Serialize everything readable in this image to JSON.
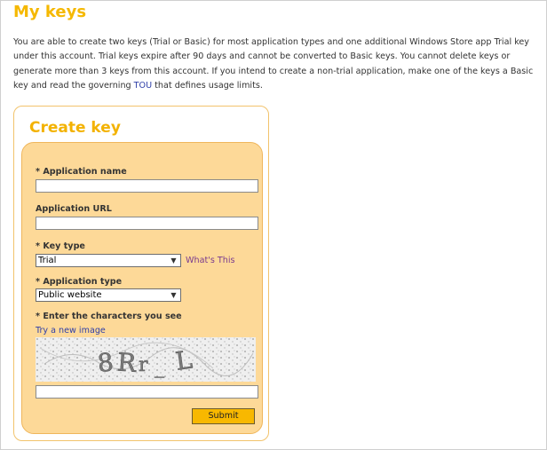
{
  "page": {
    "title": "My keys",
    "intro_text": "You are able to create two keys (Trial or Basic) for most application types and one additional Windows Store app Trial key under this account. Trial keys expire after 90 days and cannot be converted to Basic keys. You cannot delete keys or generate more than 3 keys from this account. If you intend to create a non-trial application, make one of the keys a Basic key and read the governing ",
    "tou_link": "TOU",
    "intro_text_end": " that defines usage limits."
  },
  "form": {
    "title": "Create key",
    "app_name_label": "* Application name",
    "app_name_value": "",
    "app_url_label": "Application URL",
    "app_url_value": "",
    "key_type_label": "* Key type",
    "key_type_selected": "Trial",
    "whats_this_link": "What's This",
    "app_type_label": "* Application type",
    "app_type_selected": "Public website",
    "captcha_label": "* Enter the characters you see",
    "new_image_link": "Try a new image",
    "captcha_text": "8Rr_L",
    "captcha_value": "",
    "submit_label": "Submit"
  },
  "colors": {
    "title": "#f5b800",
    "panel": "#fdd998",
    "submit": "#f8b800",
    "link_blue": "#2f3fa8",
    "link_purple": "#7a3a8e"
  }
}
